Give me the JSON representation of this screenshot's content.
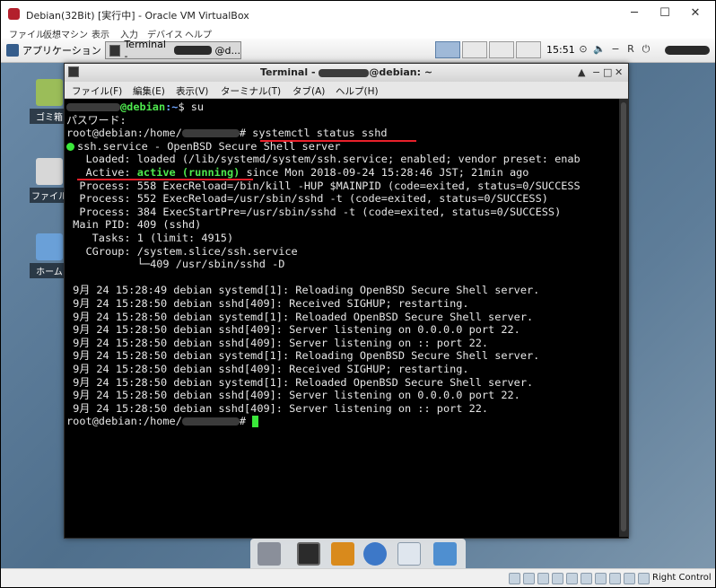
{
  "vbox": {
    "title": "Debian(32Bit) [実行中] - Oracle VM VirtualBox",
    "menu": [
      "ファイル",
      "仮想マシン",
      "表示",
      "入力",
      "デバイス",
      "ヘルプ"
    ],
    "host_key": "Right Control"
  },
  "panel": {
    "apps_label": "アプリケーション",
    "task_label": "Terminal -",
    "task_suffix": "@d...",
    "clock": "15:51"
  },
  "desktop": {
    "icons": [
      {
        "label": "ゴミ箱",
        "icon": "trash-icon"
      },
      {
        "label": "ファイルシステム",
        "icon": "drive-icon"
      },
      {
        "label": "ホーム",
        "icon": "home-folder-icon"
      }
    ]
  },
  "terminal": {
    "title_prefix": "Terminal - ",
    "title_suffix": "@debian: ~",
    "menu": [
      "ファイル(F)",
      "編集(E)",
      "表示(V)",
      "ターミナル(T)",
      "タブ(A)",
      "ヘルプ(H)"
    ],
    "lines": {
      "prompt1_host": "@debian",
      "prompt1_path": ":~",
      "prompt1_cmd": "$ su",
      "password": "パスワード:",
      "root_prefix": "root@debian:/home/",
      "cmd": "# systemctl status sshd",
      "service": "ssh.service - OpenBSD Secure Shell server",
      "loaded": "   Loaded: loaded (/lib/systemd/system/ssh.service; enabled; vendor preset: enab",
      "active_label": "   Active: ",
      "active_state": "active (running)",
      "active_rest": " since Mon 2018-09-24 15:28:46 JST; 21min ago",
      "proc1": "  Process: 558 ExecReload=/bin/kill -HUP $MAINPID (code=exited, status=0/SUCCESS",
      "proc2": "  Process: 552 ExecReload=/usr/sbin/sshd -t (code=exited, status=0/SUCCESS)",
      "proc3": "  Process: 384 ExecStartPre=/usr/sbin/sshd -t (code=exited, status=0/SUCCESS)",
      "mainpid": " Main PID: 409 (sshd)",
      "tasks": "    Tasks: 1 (limit: 4915)",
      "cgroup": "   CGroup: /system.slice/ssh.service",
      "cgroup_child": "           └─409 /usr/sbin/sshd -D",
      "log": [
        " 9月 24 15:28:49 debian systemd[1]: Reloading OpenBSD Secure Shell server.",
        " 9月 24 15:28:50 debian sshd[409]: Received SIGHUP; restarting.",
        " 9月 24 15:28:50 debian systemd[1]: Reloaded OpenBSD Secure Shell server.",
        " 9月 24 15:28:50 debian sshd[409]: Server listening on 0.0.0.0 port 22.",
        " 9月 24 15:28:50 debian sshd[409]: Server listening on :: port 22.",
        " 9月 24 15:28:50 debian systemd[1]: Reloading OpenBSD Secure Shell server.",
        " 9月 24 15:28:50 debian sshd[409]: Received SIGHUP; restarting.",
        " 9月 24 15:28:50 debian systemd[1]: Reloaded OpenBSD Secure Shell server.",
        " 9月 24 15:28:50 debian sshd[409]: Server listening on 0.0.0.0 port 22.",
        " 9月 24 15:28:50 debian sshd[409]: Server listening on :: port 22."
      ],
      "final_prefix": "root@debian:/home/",
      "final_suffix": "#"
    }
  },
  "colors": {
    "highlight_underline": "#e8202a",
    "active_green": "#4ee84e",
    "prompt_blue": "#6fa6ff"
  }
}
